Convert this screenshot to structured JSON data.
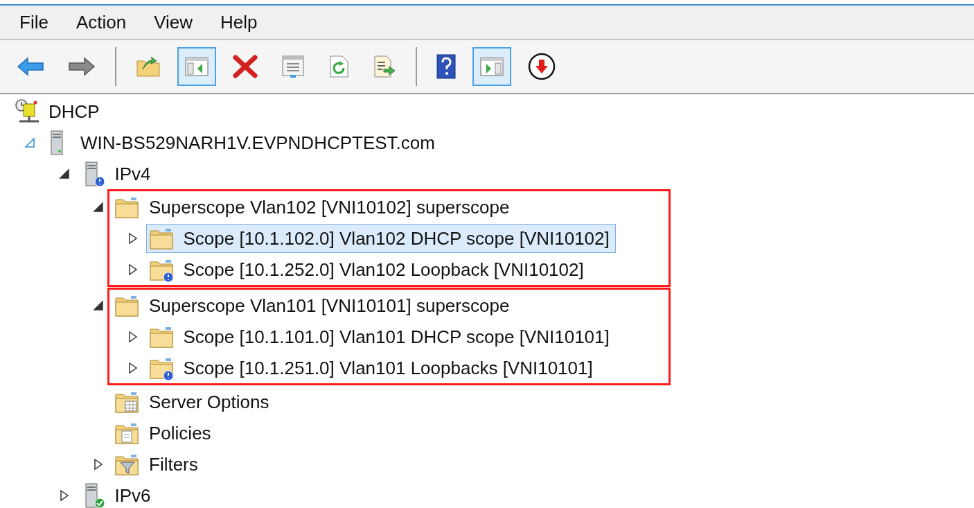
{
  "menu": [
    "File",
    "Action",
    "View",
    "Help"
  ],
  "toolbar": [
    {
      "kind": "back"
    },
    {
      "kind": "forward"
    },
    {
      "kind": "separator"
    },
    {
      "kind": "up-folder"
    },
    {
      "kind": "tree-pane",
      "pressed": true
    },
    {
      "kind": "delete"
    },
    {
      "kind": "properties"
    },
    {
      "kind": "refresh"
    },
    {
      "kind": "export"
    },
    {
      "kind": "separator"
    },
    {
      "kind": "help"
    },
    {
      "kind": "action-pane",
      "pressed": true
    },
    {
      "kind": "download"
    }
  ],
  "tree": [
    {
      "label": "DHCP",
      "kind": "dhcp",
      "children": [
        {
          "label": "WIN-BS529NARH1V.EVPNDHCPTEST.com",
          "kind": "server",
          "expanded": true,
          "children": [
            {
              "label": "IPv4",
              "kind": "ipv4",
              "expanded": true,
              "children": [
                {
                  "label": "Superscope Vlan102 [VNI10102] superscope",
                  "kind": "folder",
                  "expanded": true,
                  "highlighted": true,
                  "children": [
                    {
                      "label": "Scope [10.1.102.0] Vlan102 DHCP scope [VNI10102]",
                      "kind": "folder",
                      "expanded": false,
                      "selected": true
                    },
                    {
                      "label": "Scope [10.1.252.0] Vlan102 Loopback [VNI10102]",
                      "kind": "folder-alert",
                      "expanded": false,
                      "selected": false
                    }
                  ]
                },
                {
                  "label": "Superscope Vlan101 [VNI10101] superscope",
                  "kind": "folder",
                  "expanded": true,
                  "highlighted": true,
                  "children": [
                    {
                      "label": "Scope [10.1.101.0] Vlan101 DHCP scope [VNI10101]",
                      "kind": "folder",
                      "expanded": false,
                      "selected": false
                    },
                    {
                      "label": "Scope [10.1.251.0] Vlan101 Loopbacks [VNI10101]",
                      "kind": "folder-alert",
                      "expanded": false,
                      "selected": false
                    }
                  ]
                },
                {
                  "label": "Server Options",
                  "kind": "options"
                },
                {
                  "label": "Policies",
                  "kind": "policies"
                },
                {
                  "label": "Filters",
                  "kind": "filters",
                  "expanded": false
                }
              ]
            },
            {
              "label": "IPv6",
              "kind": "ipv6",
              "expanded": false
            }
          ]
        }
      ]
    }
  ]
}
